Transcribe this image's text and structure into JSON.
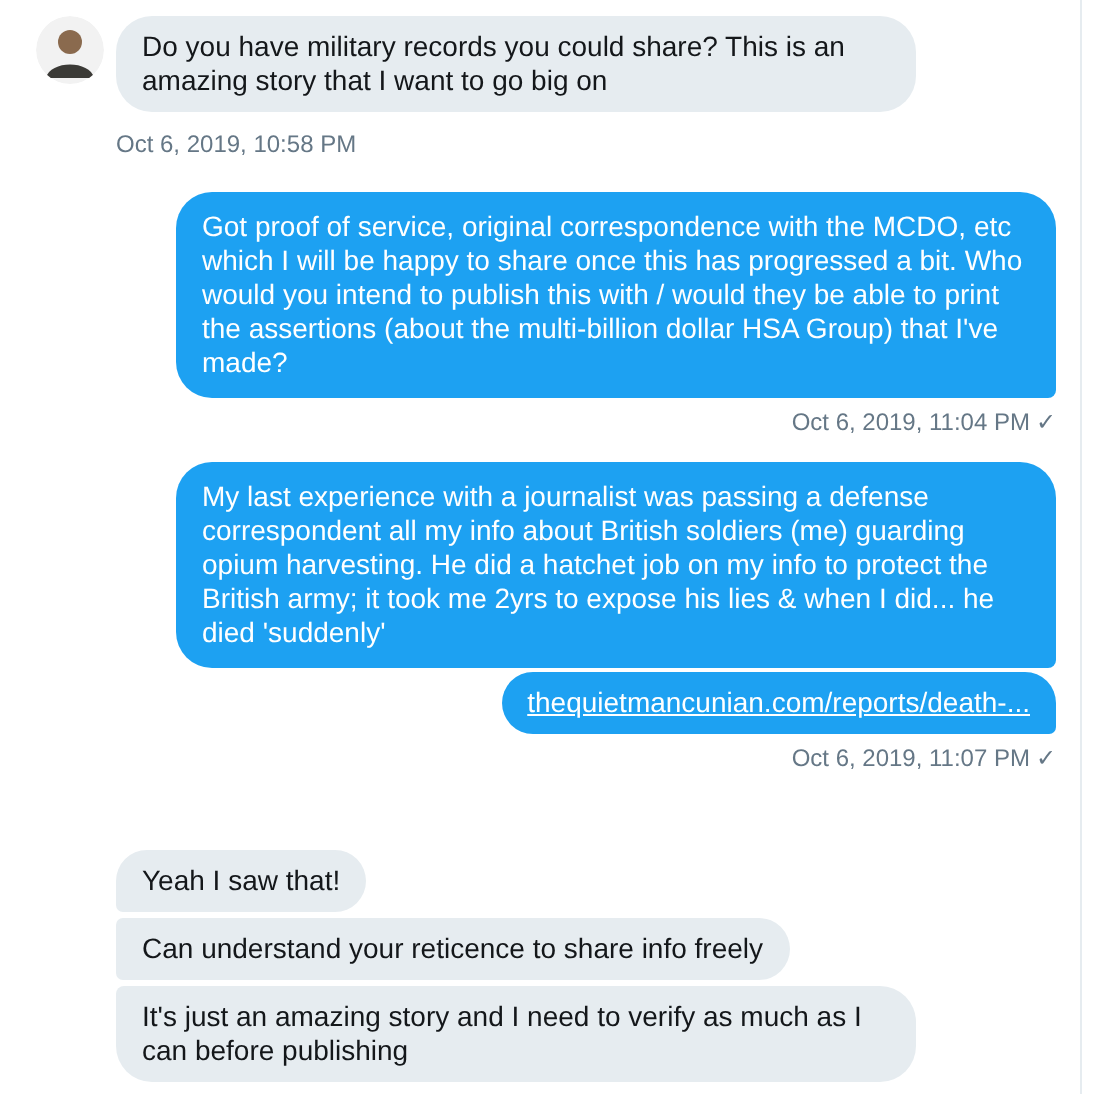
{
  "groups": [
    {
      "kind": "received",
      "avatar": true,
      "messages": [
        {
          "kind": "text",
          "text": "Do you have military records you could share? This is an amazing story that I want to go big on"
        }
      ],
      "timestamp": "Oct 6, 2019, 10:58 PM"
    },
    {
      "kind": "sent",
      "messages": [
        {
          "kind": "text",
          "text": "Got proof of service, original correspondence with the MCDO, etc which I will be happy to share once this has progressed a bit. Who would you intend to publish this with / would they be able to print the assertions (about the multi-billion dollar HSA Group) that I've made?"
        }
      ],
      "timestamp": "Oct 6, 2019, 11:04 PM",
      "check": "✓"
    },
    {
      "kind": "sent",
      "messages": [
        {
          "kind": "text",
          "text": "My last experience with a journalist was passing a defense correspondent all my info about British soldiers (me) guarding opium harvesting. He did a hatchet job on my info to protect the British army; it took me 2yrs to expose his lies & when I did... he died 'suddenly'"
        },
        {
          "kind": "link",
          "text": "thequietmancunian.com/reports/death-..."
        }
      ],
      "timestamp": "Oct 6, 2019, 11:07 PM",
      "check": "✓"
    },
    {
      "kind": "received",
      "avatar": false,
      "messages": [
        {
          "kind": "text",
          "text": "Yeah I saw that!"
        },
        {
          "kind": "text",
          "text": "Can understand your reticence to share info freely"
        },
        {
          "kind": "text",
          "text": "It's just an amazing story and I need to verify as much as I can before publishing"
        }
      ]
    }
  ]
}
